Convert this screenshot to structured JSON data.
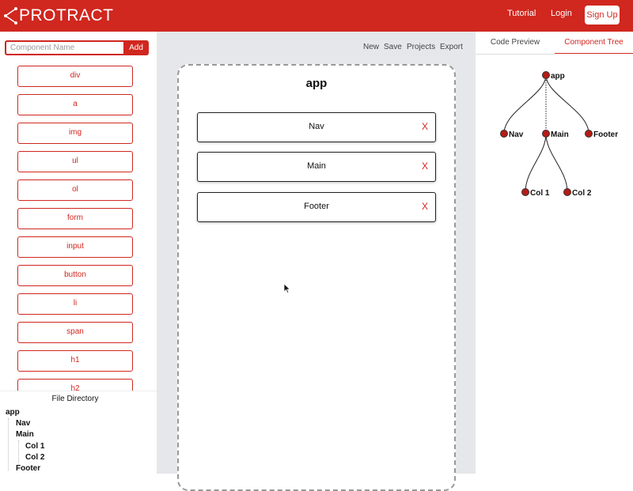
{
  "header": {
    "logo_text": "PROTRACT",
    "nav": {
      "tutorial": "Tutorial",
      "login": "Login",
      "signup": "Sign Up"
    }
  },
  "sidebar": {
    "input_placeholder": "Component Name",
    "add_label": "Add",
    "elements": [
      "div",
      "a",
      "img",
      "ul",
      "ol",
      "form",
      "input",
      "button",
      "li",
      "span",
      "h1",
      "h2"
    ],
    "file_directory": {
      "title": "File Directory",
      "tree": [
        {
          "label": "app",
          "depth": 0
        },
        {
          "label": "Nav",
          "depth": 1
        },
        {
          "label": "Main",
          "depth": 1
        },
        {
          "label": "Col 1",
          "depth": 2
        },
        {
          "label": "Col 2",
          "depth": 2
        },
        {
          "label": "Footer",
          "depth": 1
        }
      ]
    }
  },
  "toolbar": {
    "new_label": "New",
    "save_label": "Save",
    "projects_label": "Projects",
    "export_label": "Export"
  },
  "canvas": {
    "title": "app",
    "children": [
      {
        "label": "Nav",
        "remove": "X"
      },
      {
        "label": "Main",
        "remove": "X"
      },
      {
        "label": "Footer",
        "remove": "X"
      }
    ]
  },
  "right_panel": {
    "tabs": {
      "code_preview": "Code Preview",
      "component_tree": "Component Tree"
    },
    "active_tab": "Component Tree",
    "tree": {
      "root": "app",
      "level1": [
        "Nav",
        "Main",
        "Footer"
      ],
      "main_children": [
        "Col 1",
        "Col 2"
      ]
    }
  },
  "colors": {
    "brand": "#d0271f",
    "node_fill": "#b51c16",
    "canvas_bg": "#e5e7ea"
  }
}
